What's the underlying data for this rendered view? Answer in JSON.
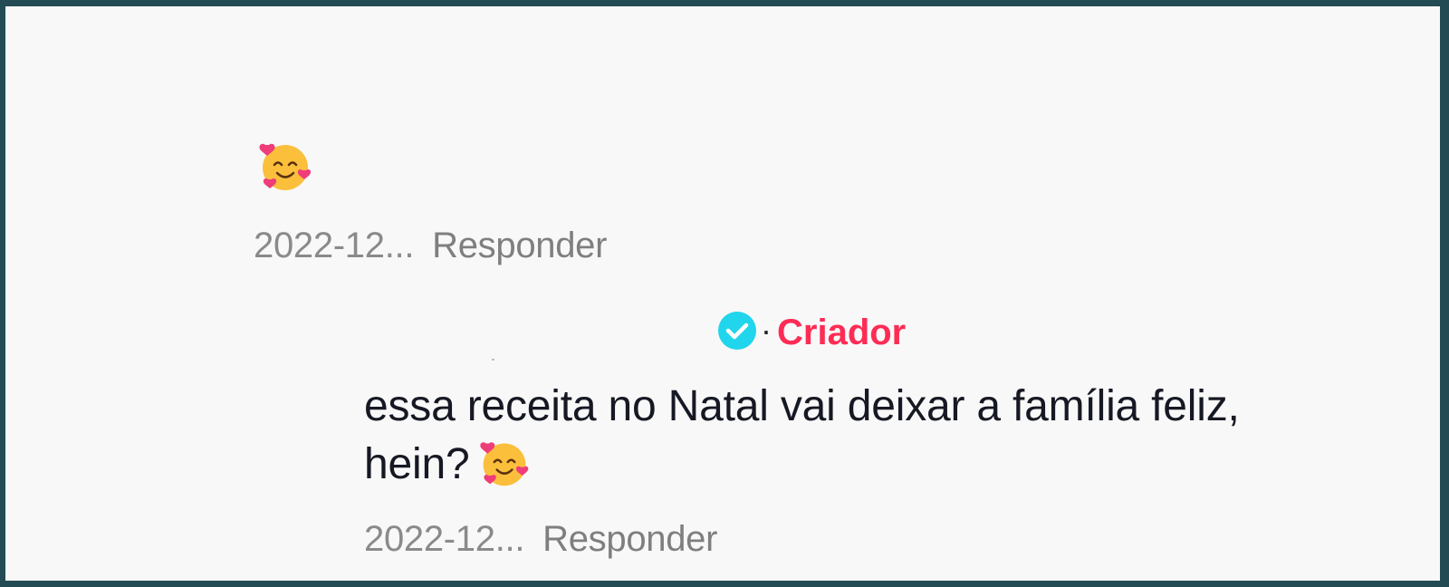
{
  "comment": {
    "emoji_icon": "smiling-face-with-hearts-icon",
    "date": "2022-12...",
    "reply_label": "Responder"
  },
  "reply": {
    "verified_icon": "verified-badge-icon",
    "separator": "·",
    "badge": "Criador",
    "text_line1": "essa receita no Natal vai deixar a família feliz,",
    "text_line2": "hein?",
    "emoji_icon": "smiling-face-with-hearts-icon",
    "date": "2022-12...",
    "reply_label": "Responder"
  },
  "colors": {
    "frame_border": "#234b53",
    "background": "#f8f8f8",
    "creator_badge": "#fe2c55",
    "verified_badge": "#20d5ec",
    "meta_text": "#8a8a8a",
    "body_text": "#161823"
  }
}
